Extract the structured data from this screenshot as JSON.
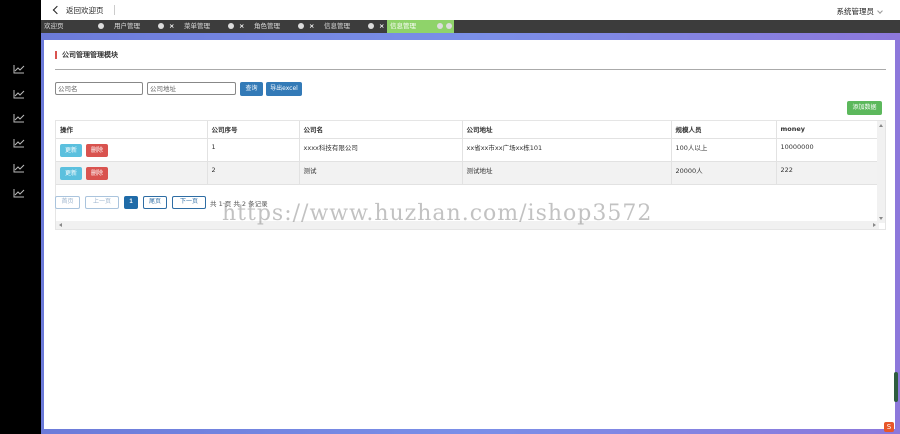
{
  "header": {
    "back_label": "返回欢迎页",
    "user_label": "系统管理员"
  },
  "tabs": [
    {
      "label": "欢迎页",
      "active": false
    },
    {
      "label": "用户管理",
      "active": false
    },
    {
      "label": "菜单管理",
      "active": false
    },
    {
      "label": "角色管理",
      "active": false
    },
    {
      "label": "信息管理",
      "active": false
    },
    {
      "label": "信息管理",
      "active": true
    }
  ],
  "tab_close": "×",
  "page": {
    "title": "公司管理管理模块",
    "search": {
      "company_name_placeholder": "公司名",
      "company_address_placeholder": "公司地址",
      "query_label": "查询",
      "export_label": "导出excel"
    },
    "add_label": "添加数据"
  },
  "table": {
    "columns": [
      "操作",
      "公司序号",
      "公司名",
      "公司地址",
      "规模人员",
      "money"
    ],
    "update_label": "更新",
    "delete_label": "删除",
    "rows": [
      {
        "id": "1",
        "name": "xxxx科技有限公司",
        "address": "xx省xx市xx广场xx栋101",
        "size": "100人以上",
        "money": "10000000"
      },
      {
        "id": "2",
        "name": "测试",
        "address": "测试地址",
        "size": "20000人",
        "money": "222"
      }
    ]
  },
  "pagination": {
    "first": "首页",
    "prev": "上一页",
    "current": "1",
    "last": "尾页",
    "next": "下一页",
    "info": "共 1 页 共 2 条记录"
  },
  "watermark": "https://www.huzhan.com/ishop3572",
  "colors": {
    "sidebar": "#000000",
    "tabbar": "#3c3c3c",
    "tab_active": "#8fd36a",
    "primary": "#337ab7",
    "success": "#5cb85c",
    "info": "#5bc0de",
    "danger": "#d9534f"
  },
  "icons": {
    "sidebar": [
      "chart-line-icon",
      "chart-line-icon",
      "chart-line-icon",
      "chart-line-icon",
      "chart-line-icon",
      "chart-line-icon"
    ]
  }
}
